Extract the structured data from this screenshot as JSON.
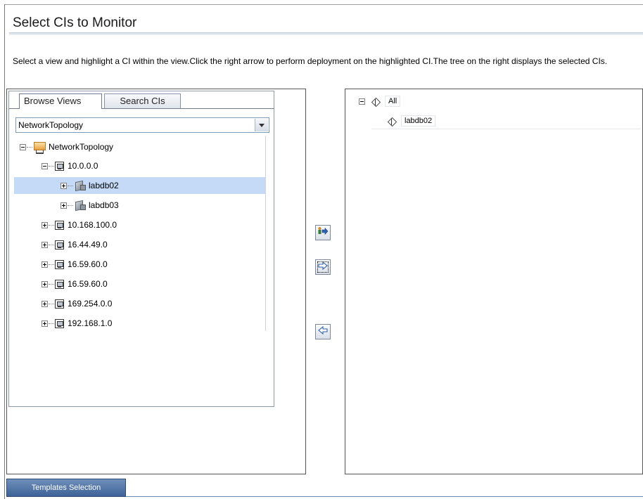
{
  "page": {
    "title": "Select CIs to Monitor",
    "instructions": "Select a view and highlight a CI within the view.Click the right arrow to perform deployment on the highlighted CI.The tree on the right displays the selected CIs."
  },
  "left_panel": {
    "tabs": [
      {
        "label": "Browse Views",
        "active": true
      },
      {
        "label": "Search CIs",
        "active": false
      }
    ],
    "view_select": {
      "value": "NetworkTopology"
    },
    "tree": {
      "root": "NetworkTopology",
      "nodes": [
        {
          "label": "10.0.0.0",
          "expanded": true,
          "children": [
            {
              "label": "labdb02",
              "selected": true
            },
            {
              "label": "labdb03",
              "selected": false
            }
          ]
        },
        {
          "label": "10.168.100.0"
        },
        {
          "label": "16.44.49.0"
        },
        {
          "label": "16.59.60.0"
        },
        {
          "label": "16.59.60.0"
        },
        {
          "label": "169.254.0.0"
        },
        {
          "label": "192.168.1.0"
        }
      ]
    }
  },
  "actions": {
    "deploy_with_children_icon": "people-arrow-icon",
    "deploy_icon": "right-arrow-icon",
    "remove_icon": "left-arrow-icon"
  },
  "right_panel": {
    "tree": {
      "root": "All",
      "children": [
        "labdb02"
      ]
    }
  },
  "footer": {
    "tab_label": "Templates Selection"
  },
  "colors": {
    "selection": "#c4daf6",
    "footer_tab": "#4a6da0"
  }
}
